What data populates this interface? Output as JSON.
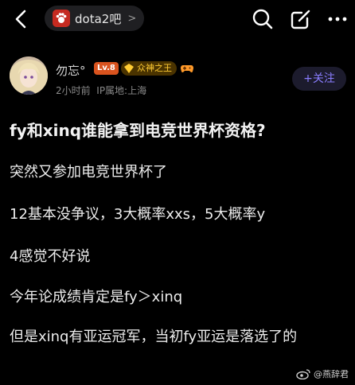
{
  "topbar": {
    "forum_name": "dota2吧",
    "forum_chevron": ">"
  },
  "author": {
    "username": "勿忘°",
    "level": "Lv.8",
    "title_badge": "众神之王",
    "time": "2小时前",
    "ip_location": "IP属地:上海",
    "follow_label": "+关注"
  },
  "post": {
    "title": "fy和xinq谁能拿到电竞世界杯资格?",
    "paragraphs": [
      "突然又参加电竞世界杯了",
      "12基本没争议，3大概率xxs，5大概率y",
      "4感觉不好说",
      "今年论成绩肯定是fy＞xinq",
      "但是xinq有亚运冠军，当初fy亚运是落选了的"
    ]
  },
  "watermark": {
    "text": "@燕辞君"
  },
  "colors": {
    "background": "#000000",
    "accent": "#8a7dff",
    "level_badge": "#d9531e",
    "title_badge": "#ffcc33"
  }
}
